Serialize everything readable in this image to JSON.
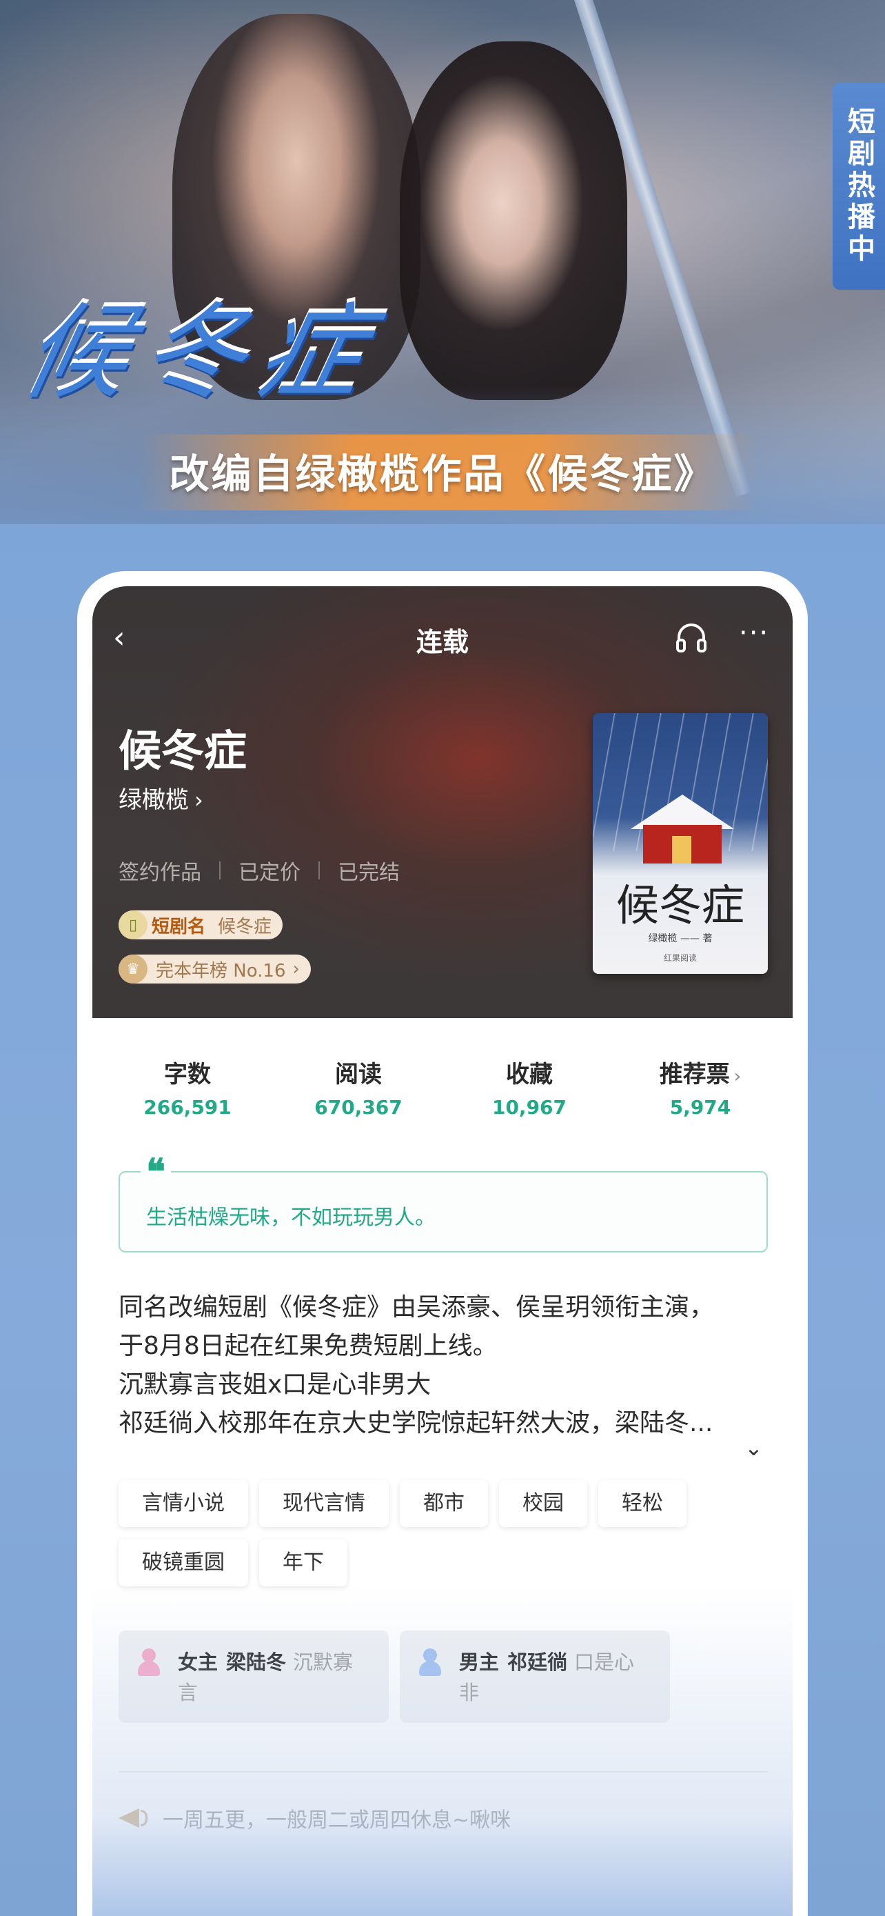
{
  "banner": {
    "title_art": "候冬症",
    "caption": "改编自绿橄榄作品《候冬症》",
    "side_tag": "短剧热播中"
  },
  "nav": {
    "back_icon": "chevron-left-icon",
    "title": "连载",
    "listen_icon": "headphones-icon",
    "more_icon": "more-dots-icon",
    "back_glyph": "‹",
    "more_glyph": "···"
  },
  "book": {
    "title": "候冬症",
    "author": "绿橄榄",
    "author_chevron": "›",
    "meta": [
      "签约作品",
      "已定价",
      "已完结"
    ],
    "drama_badge": {
      "label": "短剧名",
      "value": "候冬症"
    },
    "rank_badge": {
      "value": "完本年榜 No.16",
      "chevron": "›"
    },
    "cover": {
      "title": "候冬症",
      "author": "绿橄榄 —— 著",
      "publisher": "红果阅读"
    }
  },
  "stats": [
    {
      "label": "字数",
      "value": "266,591"
    },
    {
      "label": "阅读",
      "value": "670,367"
    },
    {
      "label": "收藏",
      "value": "10,967"
    },
    {
      "label": "推荐票",
      "value": "5,974",
      "chevron": "›"
    }
  ],
  "quote": {
    "mark": "❝",
    "text": "生活枯燥无味，不如玩玩男人。"
  },
  "intro": {
    "lines": [
      "同名改编短剧《候冬症》由吴添豪、侯呈玥领衔主演，",
      "于8月8日起在红果免费短剧上线。",
      "沉默寡言丧姐x口是心非男大",
      "祁廷徜入校那年在京大史学院惊起轩然大波，梁陆冬..."
    ],
    "expand_glyph": "⌄"
  },
  "tags": [
    "言情小说",
    "现代言情",
    "都市",
    "校园",
    "轻松",
    "破镜重圆",
    "年下"
  ],
  "roles": [
    {
      "label": "女主",
      "name": "梁陆冬",
      "desc": "沉默寡言",
      "color": "#f4a6c8"
    },
    {
      "label": "男主",
      "name": "祁廷徜",
      "desc": "口是心非",
      "color": "#9cbef0"
    }
  ],
  "notice": {
    "icon": "megaphone-icon",
    "text": "一周五更，一般周二或周四休息~啾咪"
  },
  "colors": {
    "accent": "#22aa88",
    "badge_bg": "#f6e8d8",
    "hero_bg": "#3c3838"
  }
}
